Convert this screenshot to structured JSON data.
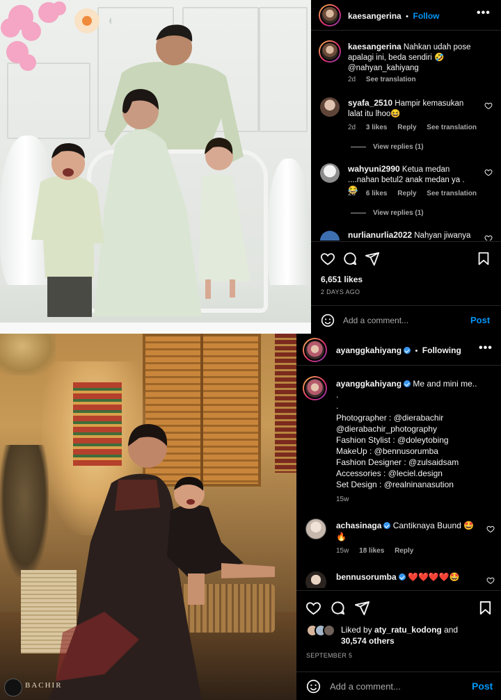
{
  "post1": {
    "username": "kaesangerina",
    "follow_label": "Follow",
    "more_label": "•••",
    "caption": {
      "username": "kaesangerina",
      "text": "Nahkan udah pose apalagi ini, beda sendiri 🤣 @nahyan_kahiyang",
      "time": "2d",
      "see_translation": "See translation"
    },
    "comments": [
      {
        "username": "syafa_2510",
        "text": "Hampir kemasukan lalat itu lhoo😆",
        "time": "2d",
        "likes": "3 likes",
        "reply": "Reply",
        "see_translation": "See translation",
        "view_replies": "View replies (1)"
      },
      {
        "username": "wahyuni2990",
        "text": "Ketua medan ....nahan betul2 anak medan ya . 😂",
        "time": "2d",
        "likes": "6 likes",
        "reply": "Reply",
        "see_translation": "See translation",
        "view_replies": "View replies (1)"
      },
      {
        "username": "nurlianurlia2022",
        "text": "Nahyan jiwanya"
      }
    ],
    "likes": "6,651 likes",
    "date": "2 DAYS AGO",
    "add_comment_placeholder": "Add a comment...",
    "post_label": "Post"
  },
  "post2": {
    "username": "ayanggkahiyang",
    "separator": "•",
    "following_label": "Following",
    "more_label": "•••",
    "caption": {
      "username": "ayanggkahiyang",
      "first_line": "Me and mini me..",
      "dot1": ".",
      "dot2": ".",
      "lines": [
        "Photographer : @dierabachir",
        "@dierabachir_photography",
        "Fashion Stylist : @doleytobing",
        "MakeUp : @bennusorumba",
        "Fashion Designer : @zulsaidsam",
        "Accessories : @leciel.design",
        "Set Design : @realninanasution"
      ],
      "time": "15w"
    },
    "comments": [
      {
        "username": "achasinaga",
        "text": "Cantiknaya Buund 🤩🔥",
        "time": "15w",
        "likes": "18 likes",
        "reply": "Reply"
      },
      {
        "username": "bennusorumba",
        "text": "❤️❤️❤️❤️🤩"
      }
    ],
    "liked_by_prefix": "Liked by",
    "liked_by_user": "aty_ratu_kodong",
    "liked_by_and": "and",
    "liked_by_others": "30,574 others",
    "date": "SEPTEMBER 5",
    "add_comment_placeholder": "Add a comment...",
    "post_label": "Post"
  },
  "watermark": "BACHIR",
  "colors": {
    "background": "#000000",
    "text": "#f5f5f5",
    "secondary": "#a8a8a8",
    "link": "#0095f6",
    "divider": "#262626",
    "heart_red": "#ed4956"
  },
  "icons": [
    "heart-icon",
    "comment-icon",
    "share-icon",
    "bookmark-icon",
    "emoji-icon",
    "verified-badge-icon",
    "more-icon"
  ]
}
